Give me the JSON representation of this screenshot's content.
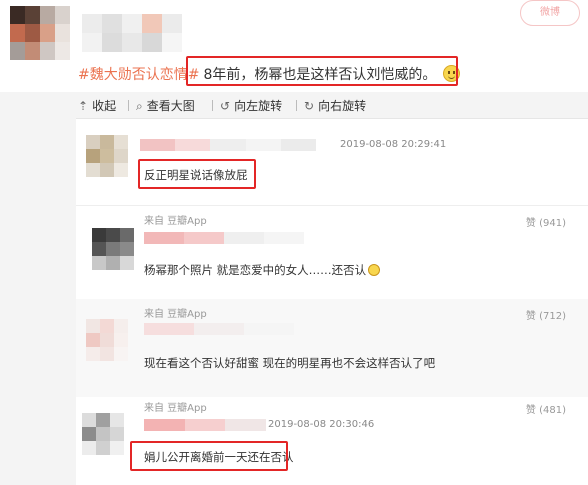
{
  "post": {
    "stamp": "微博",
    "hashtag": "#魏大勋否认恋情#",
    "text": "8年前，杨幂也是这样否认刘恺威的。"
  },
  "toolbar": [
    {
      "icon": "up-arrow-icon",
      "glyph": "⇡",
      "label": "收起"
    },
    {
      "icon": "search-icon",
      "glyph": "⌕",
      "label": "查看大图"
    },
    {
      "icon": "rotate-left-icon",
      "glyph": "↺",
      "label": "向左旋转"
    },
    {
      "icon": "rotate-right-icon",
      "glyph": "↻",
      "label": "向右旋转"
    }
  ],
  "comments": [
    {
      "time": "2019-08-08 20:29:41",
      "text": "反正明星说话像放屁",
      "source": "",
      "likes": ""
    },
    {
      "source": "来自 豆瓣App",
      "likes": "赞 (941)",
      "text": "杨幂那个照片 就是恋爱中的女人……还否认",
      "time": ""
    },
    {
      "source": "来自 豆瓣App",
      "likes": "赞 (712)",
      "text": "现在看这个否认好甜蜜 现在的明星再也不会这样否认了吧",
      "time": ""
    },
    {
      "source": "来自 豆瓣App",
      "likes": "赞 (481)",
      "time": "2019-08-08 20:30:46",
      "text": "娟儿公开离婚前一天还在否认"
    }
  ],
  "colors": {
    "highlight": "#e32626",
    "hashtag": "#eb7350"
  }
}
